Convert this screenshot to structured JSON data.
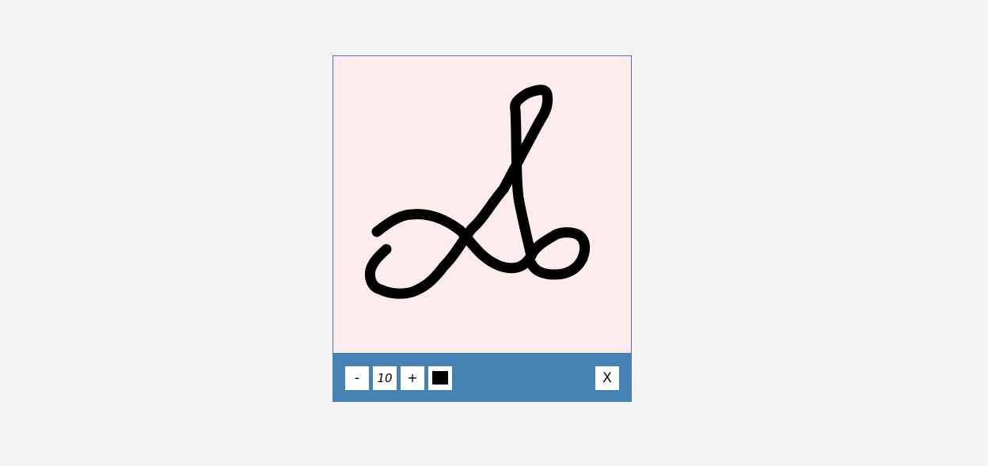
{
  "toolbar": {
    "decrease_label": "-",
    "brush_size": "10",
    "increase_label": "+",
    "close_label": "X",
    "pen_color": "#000000"
  },
  "canvas": {
    "background_color": "#feecec",
    "toolbar_color": "#4682b4"
  }
}
